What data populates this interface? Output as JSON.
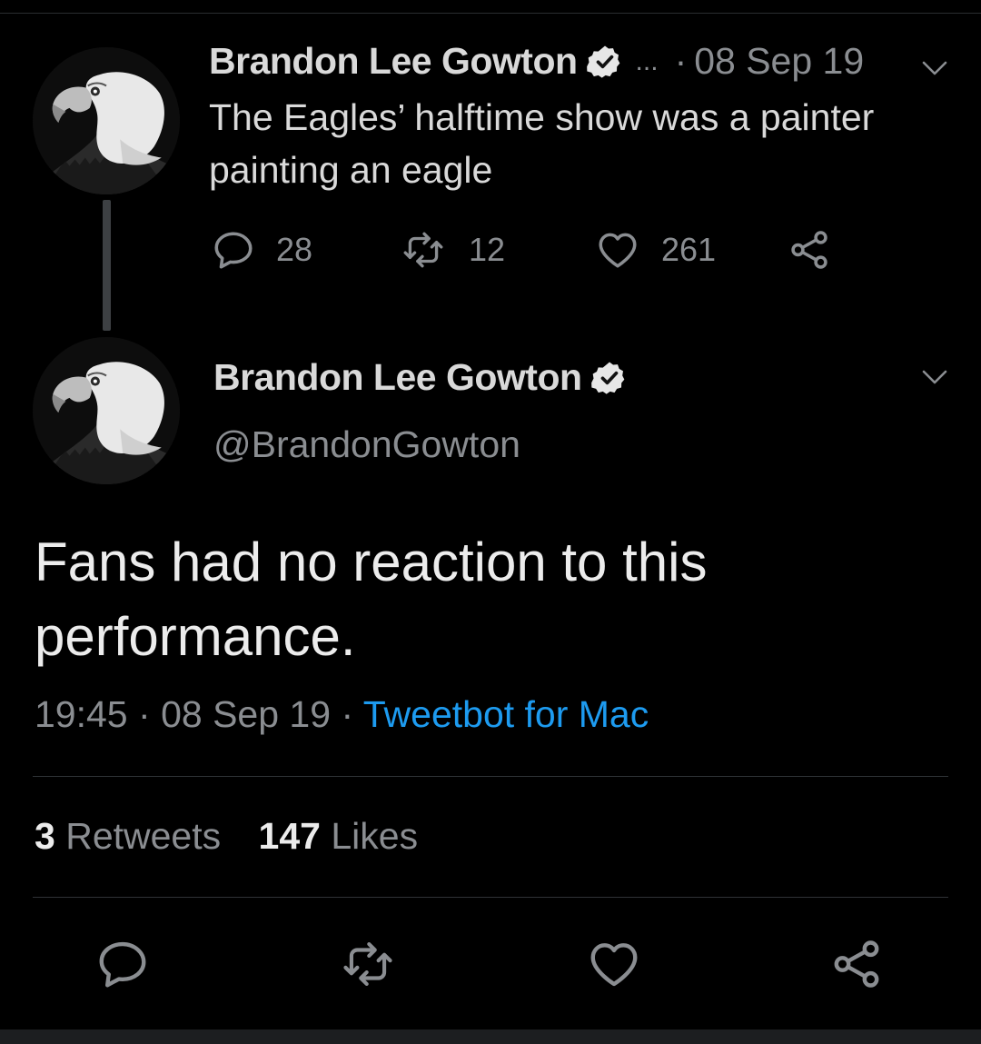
{
  "parent_tweet": {
    "display_name": "Brandon Lee Gowton",
    "ellipsis": "...",
    "separator": "·",
    "date": "08 Sep 19",
    "text": "The Eagles’ halftime show was a painter painting an eagle",
    "replies": "28",
    "retweets": "12",
    "likes": "261",
    "avatar_icon": "bald-eagle-icon",
    "verified_icon": "verified-badge-icon"
  },
  "main_tweet": {
    "display_name": "Brandon Lee Gowton",
    "handle": "@BrandonGowton",
    "text": "Fans had no reaction to this performance.",
    "time": "19:45",
    "separator": "·",
    "date": "08 Sep 19",
    "client": "Tweetbot for Mac",
    "retweet_count": "3",
    "retweet_label": "Retweets",
    "like_count": "147",
    "like_label": "Likes"
  },
  "colors": {
    "background": "#000000",
    "primary_text": "#d9d9d9",
    "secondary_text": "#8a8d91",
    "link": "#1d9bf0",
    "divider": "#2f3336"
  },
  "icons": {
    "reply": "reply-bubble-icon",
    "retweet": "retweet-icon",
    "like": "heart-icon",
    "share": "share-icon",
    "menu": "chevron-down-icon"
  }
}
